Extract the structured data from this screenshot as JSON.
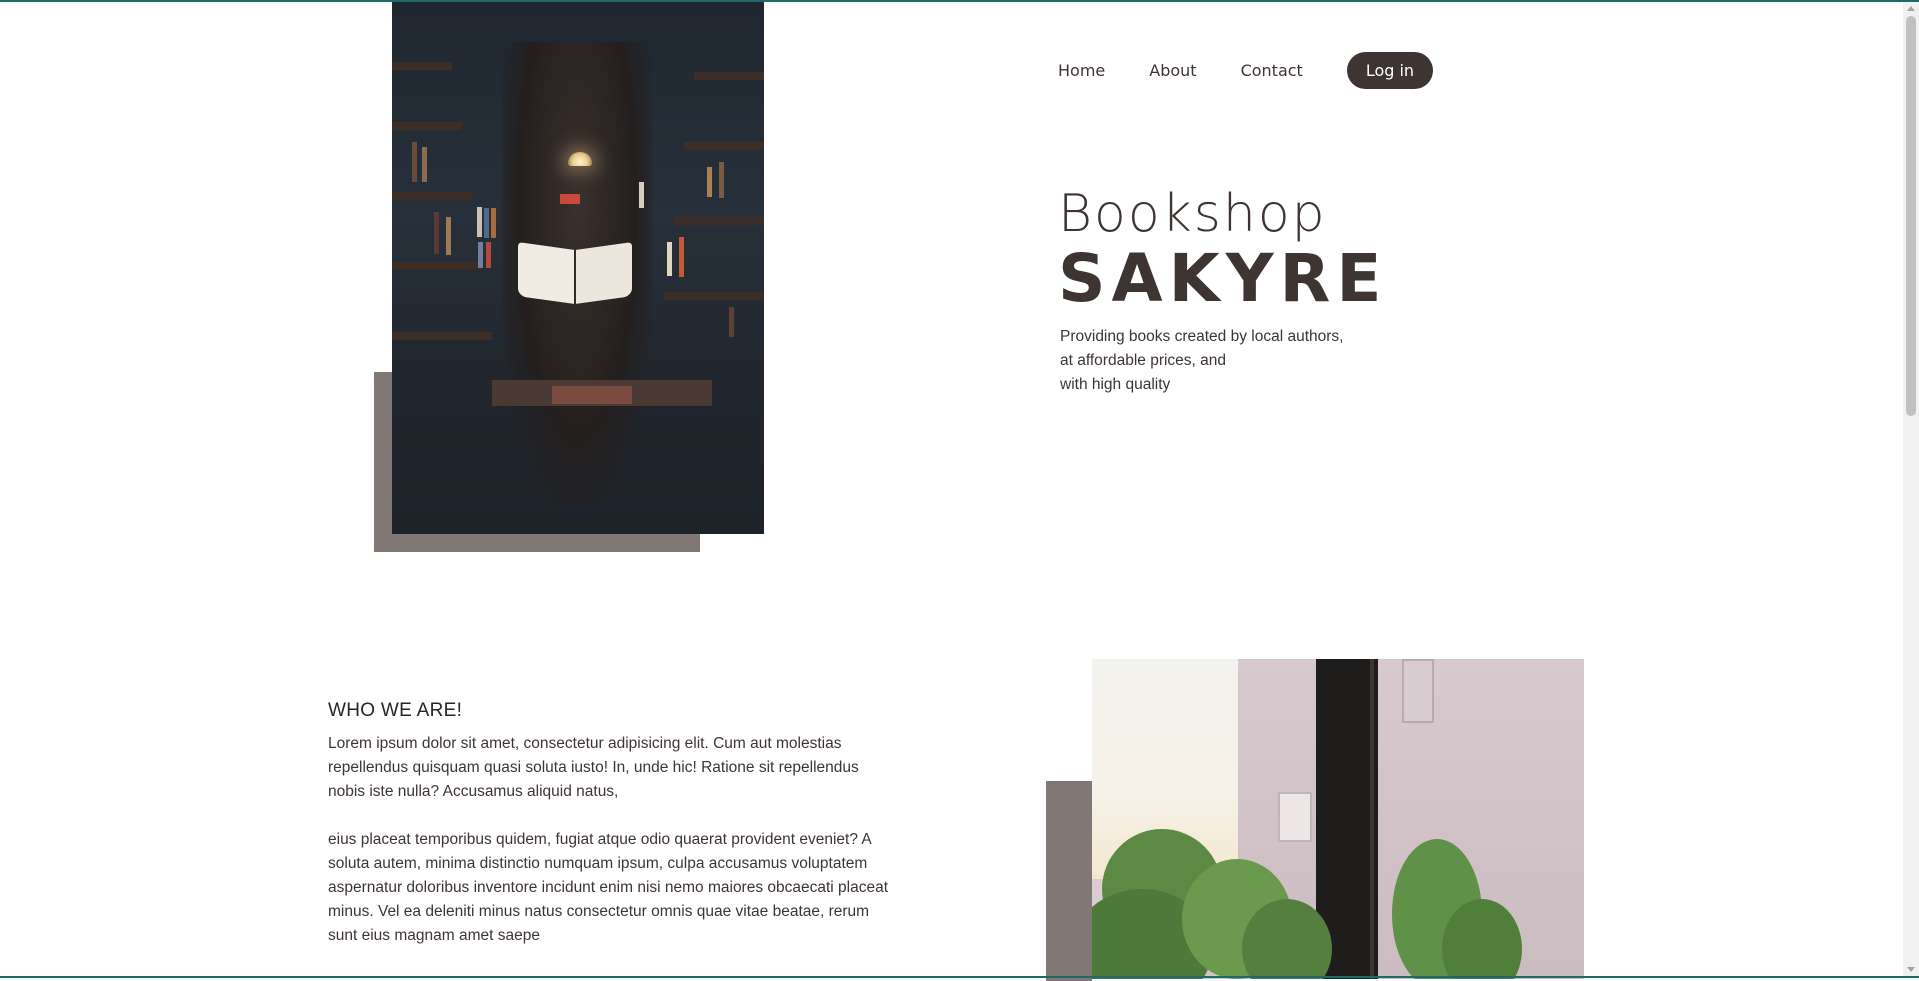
{
  "nav": {
    "links": [
      "Home",
      "About",
      "Contact"
    ],
    "login_label": "Log in"
  },
  "hero": {
    "title_light": "Bookshop",
    "title_bold": "SAKYRE",
    "tagline": [
      "Providing books created by local authors,",
      "at affordable prices, and",
      "with high quality"
    ]
  },
  "about": {
    "title": "WHO WE ARE!",
    "paragraph_1": "Lorem ipsum dolor sit amet, consectetur adipisicing elit. Cum aut molestias repellendus quisquam quasi soluta iusto! In, unde hic! Ratione sit repellendus nobis iste nulla? Accusamus aliquid natus,",
    "paragraph_2": "eius placeat temporibus quidem, fugiat atque odio quaerat provident eveniet? A soluta autem, minima distinctio numquam ipsum, culpa accusamus voluptatem aspernatur doloribus inventore incidunt enim nisi nemo maiores obcaecati placeat minus. Vel ea deleniti minus natus consectetur omnis quae vitae beatae, rerum sunt eius magnam amet saepe"
  },
  "colors": {
    "primary": "#3e3533",
    "accent_shadow": "#817876",
    "background": "#ffffff"
  }
}
